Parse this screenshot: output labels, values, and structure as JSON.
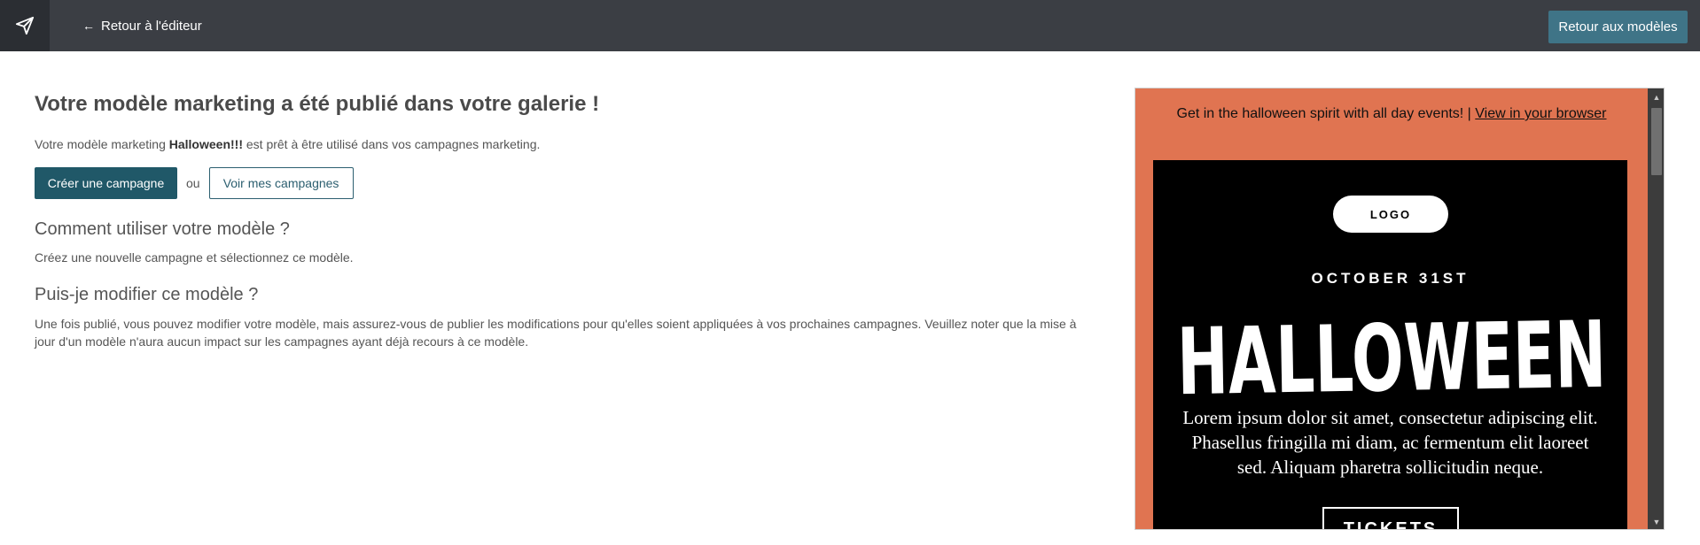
{
  "topbar": {
    "logo_icon": "paper-plane-icon",
    "back_arrow": "←",
    "back_label": "Retour à l'éditeur",
    "return_button": "Retour aux modèles",
    "colors": {
      "bar": "#3b3e44",
      "logo_box": "#2b2e33",
      "button": "#3f7487"
    }
  },
  "main": {
    "title": "Votre modèle marketing a été publié dans votre galerie !",
    "description_prefix": "Votre modèle marketing ",
    "template_name": "Halloween!!!",
    "description_suffix": " est prêt à être utilisé dans vos campagnes marketing.",
    "create_campaign": "Créer une campagne",
    "or_text": "ou",
    "view_campaigns": "Voir mes campagnes",
    "faq": [
      {
        "question": "Comment utiliser votre modèle ?",
        "answer": "Créez une nouvelle campagne et sélectionnez ce modèle."
      },
      {
        "question": "Puis-je modifier ce modèle ?",
        "answer": "Une fois publié, vous pouvez modifier votre modèle, mais assurez-vous de publier les modifications pour qu'elles soient appliquées à vos prochaines campagnes. Veuillez noter que la mise à jour d'un modèle n'aura aucun impact sur les campagnes ayant déjà recours à ce modèle."
      }
    ],
    "colors": {
      "primary": "#205868",
      "outline": "#2c5f70"
    }
  },
  "preview": {
    "preheader_text": "Get in the halloween spirit with all day events!  | ",
    "preheader_link": "View in your browser",
    "logo_label": "LOGO",
    "date": "OCTOBER 31ST",
    "headline": "HALLOWEEN",
    "body": "Lorem ipsum dolor sit amet, consectetur adipiscing elit. Phasellus fringilla mi diam, ac fermentum elit laoreet sed. Aliquam pharetra sollicitudin neque.",
    "cta": "TICKETS",
    "colors": {
      "background": "#e07451",
      "hero": "#000000",
      "text": "#ffffff"
    }
  }
}
